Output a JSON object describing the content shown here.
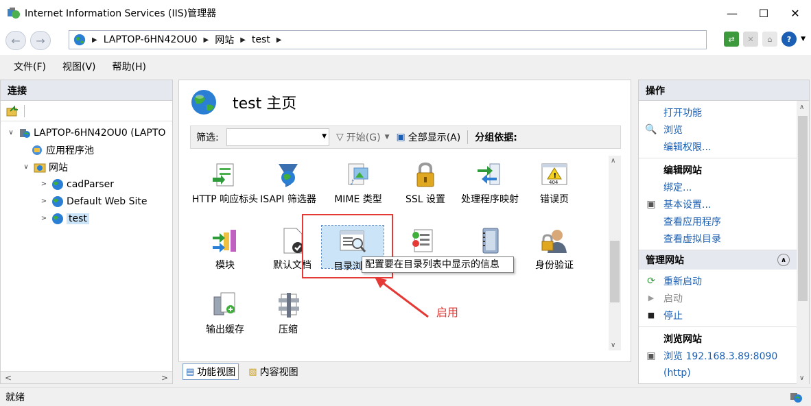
{
  "window": {
    "title": "Internet Information Services (IIS)管理器",
    "minimize": "—",
    "maximize": "☐",
    "close": "✕"
  },
  "address": {
    "crumbs": [
      "LAPTOP-6HN42OU0",
      "网站",
      "test"
    ],
    "help": "?"
  },
  "menu": [
    "文件(F)",
    "视图(V)",
    "帮助(H)"
  ],
  "connections": {
    "title": "连接",
    "tree": {
      "server": "LAPTOP-6HN42OU0 (LAPTO",
      "app_pools": "应用程序池",
      "sites": "网站",
      "site_items": [
        "cadParser",
        "Default Web Site",
        "test"
      ]
    }
  },
  "main": {
    "title": "test 主页",
    "filter": {
      "label": "筛选:",
      "value": "",
      "start": "开始(G)",
      "show_all": "全部显示(A)",
      "group_by": "分组依据:"
    },
    "features": [
      {
        "label": "HTTP 响应标头",
        "icon": "http-response-headers-icon"
      },
      {
        "label": "ISAPI 筛选器",
        "icon": "isapi-filters-icon"
      },
      {
        "label": "MIME 类型",
        "icon": "mime-types-icon"
      },
      {
        "label": "SSL 设置",
        "icon": "ssl-lock-icon"
      },
      {
        "label": "处理程序映射",
        "icon": "handler-mappings-icon"
      },
      {
        "label": "错误页",
        "icon": "error-pages-icon"
      },
      {
        "label": "模块",
        "icon": "modules-icon"
      },
      {
        "label": "默认文档",
        "icon": "default-document-icon"
      },
      {
        "label": "目录浏览",
        "icon": "directory-browsing-icon"
      },
      {
        "label": "",
        "icon": "logging-icon"
      },
      {
        "label": "",
        "icon": "request-filtering-icon"
      },
      {
        "label": "身份验证",
        "icon": "authentication-icon"
      },
      {
        "label": "输出缓存",
        "icon": "output-caching-icon"
      },
      {
        "label": "压缩",
        "icon": "compression-icon"
      }
    ],
    "tooltip": "配置要在目录列表中显示的信息",
    "annotation": "启用",
    "tabs": [
      "功能视图",
      "内容视图"
    ]
  },
  "actions": {
    "title": "操作",
    "items": [
      {
        "label": "打开功能",
        "icon": ""
      },
      {
        "label": "浏览",
        "icon": "explore-icon"
      },
      {
        "label": "编辑权限...",
        "icon": ""
      }
    ],
    "edit_site": {
      "title": "编辑网站",
      "items": [
        "绑定...",
        "基本设置...",
        "查看应用程序",
        "查看虚拟目录"
      ]
    },
    "manage_site": {
      "title": "管理网站",
      "items": [
        "重新启动",
        "启动",
        "停止"
      ]
    },
    "browse_site": {
      "title": "浏览网站",
      "items": [
        "浏览 192.168.3.89:8090",
        "(http)"
      ]
    }
  },
  "status": {
    "text": "就绪"
  }
}
